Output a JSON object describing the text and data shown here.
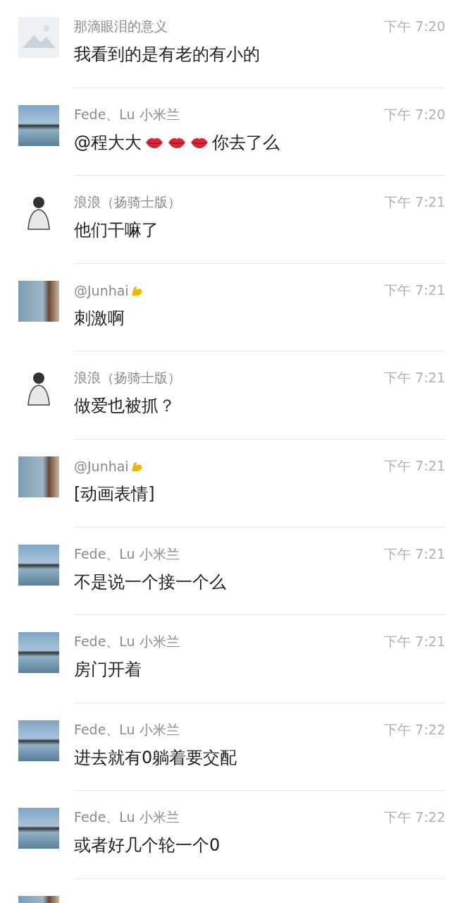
{
  "messages": [
    {
      "avatar": {
        "kind": "placeholder"
      },
      "sender": [
        {
          "kind": "text",
          "text": "那滴眼泪的意义"
        }
      ],
      "time": "下午 7:20",
      "body": [
        {
          "kind": "text",
          "text": "我看到的是有老的有小的"
        }
      ]
    },
    {
      "avatar": {
        "kind": "railing"
      },
      "sender": [
        {
          "kind": "text",
          "text": "Fede、Lu 小米兰"
        }
      ],
      "time": "下午 7:20",
      "body": [
        {
          "kind": "text",
          "text": "@程大大"
        },
        {
          "kind": "lips"
        },
        {
          "kind": "lips"
        },
        {
          "kind": "lips"
        },
        {
          "kind": "text",
          "text": "你去了么"
        }
      ]
    },
    {
      "avatar": {
        "kind": "figure"
      },
      "sender": [
        {
          "kind": "text",
          "text": "浪浪（扬骑士版）"
        }
      ],
      "time": "下午 7:21",
      "body": [
        {
          "kind": "text",
          "text": "他们干嘛了"
        }
      ]
    },
    {
      "avatar": {
        "kind": "sea"
      },
      "sender": [
        {
          "kind": "text",
          "text": "@Junhai"
        },
        {
          "kind": "arm"
        }
      ],
      "time": "下午 7:21",
      "body": [
        {
          "kind": "text",
          "text": "刺激啊"
        }
      ]
    },
    {
      "avatar": {
        "kind": "figure"
      },
      "sender": [
        {
          "kind": "text",
          "text": "浪浪（扬骑士版）"
        }
      ],
      "time": "下午 7:21",
      "body": [
        {
          "kind": "text",
          "text": "做爱也被抓？"
        }
      ]
    },
    {
      "avatar": {
        "kind": "sea"
      },
      "sender": [
        {
          "kind": "text",
          "text": "@Junhai"
        },
        {
          "kind": "arm"
        }
      ],
      "time": "下午 7:21",
      "body": [
        {
          "kind": "text",
          "text": "[动画表情]"
        }
      ]
    },
    {
      "avatar": {
        "kind": "railing"
      },
      "sender": [
        {
          "kind": "text",
          "text": "Fede、Lu 小米兰"
        }
      ],
      "time": "下午 7:21",
      "body": [
        {
          "kind": "text",
          "text": "不是说一个接一个么"
        }
      ]
    },
    {
      "avatar": {
        "kind": "railing"
      },
      "sender": [
        {
          "kind": "text",
          "text": "Fede、Lu 小米兰"
        }
      ],
      "time": "下午 7:21",
      "body": [
        {
          "kind": "text",
          "text": "房门开着"
        }
      ]
    },
    {
      "avatar": {
        "kind": "railing"
      },
      "sender": [
        {
          "kind": "text",
          "text": "Fede、Lu 小米兰"
        }
      ],
      "time": "下午 7:22",
      "body": [
        {
          "kind": "text",
          "text": "进去就有0躺着要交配"
        }
      ]
    },
    {
      "avatar": {
        "kind": "railing"
      },
      "sender": [
        {
          "kind": "text",
          "text": "Fede、Lu 小米兰"
        }
      ],
      "time": "下午 7:22",
      "body": [
        {
          "kind": "text",
          "text": "或者好几个轮一个0"
        }
      ]
    },
    {
      "avatar": {
        "kind": "sea"
      }
    }
  ]
}
